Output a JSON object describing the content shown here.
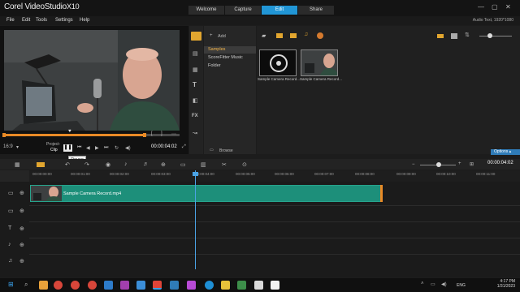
{
  "app": {
    "logo_main": "Corel VideoStudio",
    "logo_version": "X10",
    "audio_info": "Audio Text,  1920*1080"
  },
  "tabs": [
    {
      "label": "Welcome"
    },
    {
      "label": "Capture"
    },
    {
      "label": "Edit"
    },
    {
      "label": "Share"
    }
  ],
  "menu": [
    {
      "label": "File"
    },
    {
      "label": "Edit"
    },
    {
      "label": "Tools"
    },
    {
      "label": "Settings"
    },
    {
      "label": "Help"
    }
  ],
  "player": {
    "aspect": "16:9",
    "project_label": "Project-",
    "clip_label": "Clip",
    "timecode": "00:00:04:02",
    "pause_tooltip": "Pause"
  },
  "library": {
    "add_label": "Add",
    "tree": [
      "Samples",
      "ScoreFitter Music",
      "Folder"
    ],
    "browse_label": "Browse",
    "thumbs": [
      {
        "label": "Sample Camera Record..."
      },
      {
        "label": "Sample Camera Record..."
      }
    ],
    "options_label": "Options"
  },
  "timeline": {
    "ticks": [
      "00:00:00:00",
      "00:00:01:00",
      "00:00:02:00",
      "00:00:03:00",
      "00:00:04:00",
      "00:00:05:00",
      "00:00:06:00",
      "00:00:07:00",
      "00:00:08:00",
      "00:00:09:00",
      "00:00:10:00",
      "00:00:11:00",
      "00:00:12:00"
    ],
    "clip_label": "Sample Camera Record.mp4"
  },
  "taskbar": {
    "lang": "ENG",
    "time": "4:17 PM",
    "date": "1/31/2023"
  },
  "colors": {
    "accent": "#2196d6",
    "clip": "#1d8f7a",
    "scrub": "#e98a26"
  }
}
